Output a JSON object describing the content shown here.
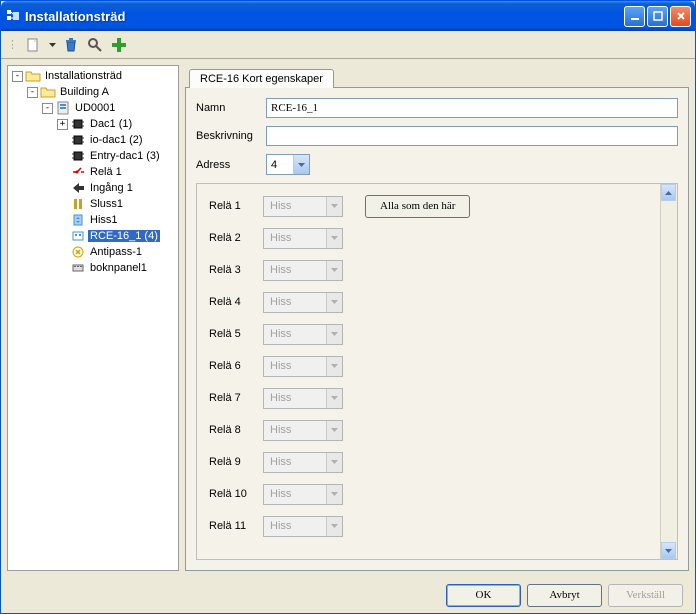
{
  "window": {
    "title": "Installationsträd"
  },
  "toolbar": {
    "new_icon": "new",
    "delete_icon": "trash",
    "search_icon": "magnifier",
    "add_icon": "plus"
  },
  "tree": {
    "nodes": [
      {
        "indent": 0,
        "toggle": "-",
        "icon": "folder-open",
        "label": "Installationsträd",
        "selected": false
      },
      {
        "indent": 1,
        "toggle": "-",
        "icon": "folder-open",
        "label": "Building A",
        "selected": false
      },
      {
        "indent": 2,
        "toggle": "-",
        "icon": "board",
        "label": "UD0001",
        "selected": false
      },
      {
        "indent": 3,
        "toggle": "+",
        "icon": "chip",
        "label": "Dac1 (1)",
        "selected": false
      },
      {
        "indent": 3,
        "toggle": "",
        "icon": "chip",
        "label": "io-dac1 (2)",
        "selected": false
      },
      {
        "indent": 3,
        "toggle": "",
        "icon": "chip",
        "label": "Entry-dac1 (3)",
        "selected": false
      },
      {
        "indent": 3,
        "toggle": "",
        "icon": "relay",
        "label": "Relä 1",
        "selected": false
      },
      {
        "indent": 3,
        "toggle": "",
        "icon": "input",
        "label": "Ingång 1",
        "selected": false
      },
      {
        "indent": 3,
        "toggle": "",
        "icon": "gate",
        "label": "Sluss1",
        "selected": false
      },
      {
        "indent": 3,
        "toggle": "",
        "icon": "elevator",
        "label": "Hiss1",
        "selected": false
      },
      {
        "indent": 3,
        "toggle": "",
        "icon": "rce",
        "label": "RCE-16_1 (4)",
        "selected": true
      },
      {
        "indent": 3,
        "toggle": "",
        "icon": "antipass",
        "label": "Antipass-1",
        "selected": false
      },
      {
        "indent": 3,
        "toggle": "",
        "icon": "panel",
        "label": "boknpanel1",
        "selected": false
      }
    ]
  },
  "tab": {
    "title": "RCE-16 Kort egenskaper"
  },
  "fields": {
    "name_label": "Namn",
    "name_value": "RCE-16_1",
    "desc_label": "Beskrivning",
    "desc_value": "",
    "addr_label": "Adress",
    "addr_value": "4"
  },
  "relays": {
    "button_all": "Alla som den här",
    "option": "Hiss",
    "rows": [
      {
        "label": "Relä 1"
      },
      {
        "label": "Relä 2"
      },
      {
        "label": "Relä 3"
      },
      {
        "label": "Relä 4"
      },
      {
        "label": "Relä 5"
      },
      {
        "label": "Relä 6"
      },
      {
        "label": "Relä 7"
      },
      {
        "label": "Relä 8"
      },
      {
        "label": "Relä 9"
      },
      {
        "label": "Relä 10"
      },
      {
        "label": "Relä 11"
      }
    ]
  },
  "footer": {
    "ok": "OK",
    "cancel": "Avbryt",
    "apply": "Verkställ"
  }
}
